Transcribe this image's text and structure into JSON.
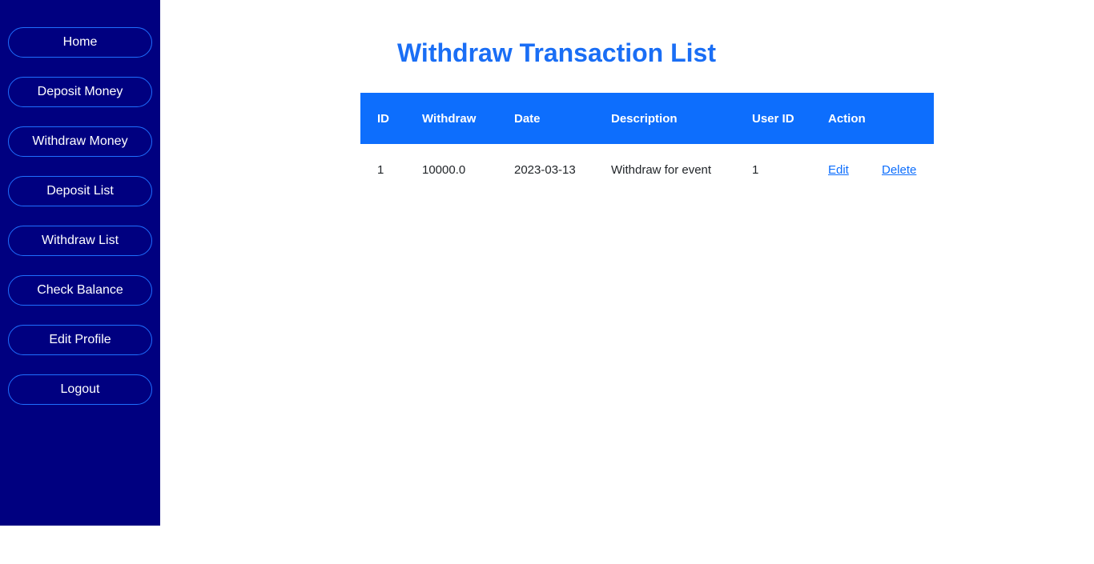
{
  "sidebar": {
    "items": [
      {
        "label": "Home"
      },
      {
        "label": "Deposit Money"
      },
      {
        "label": "Withdraw Money"
      },
      {
        "label": "Deposit List"
      },
      {
        "label": "Withdraw List"
      },
      {
        "label": "Check Balance"
      },
      {
        "label": "Edit Profile"
      },
      {
        "label": "Logout"
      }
    ]
  },
  "main": {
    "title": "Withdraw Transaction List",
    "table": {
      "headers": [
        "ID",
        "Withdraw",
        "Date",
        "Description",
        "User ID",
        "Action"
      ],
      "rows": [
        {
          "id": "1",
          "withdraw": "10000.0",
          "date": "2023-03-13",
          "description": "Withdraw for event",
          "user_id": "1",
          "edit_label": "Edit",
          "delete_label": "Delete"
        }
      ]
    }
  },
  "colors": {
    "sidebar_bg": "#000080",
    "accent": "#0d6efd",
    "title": "#1a6ef5"
  }
}
